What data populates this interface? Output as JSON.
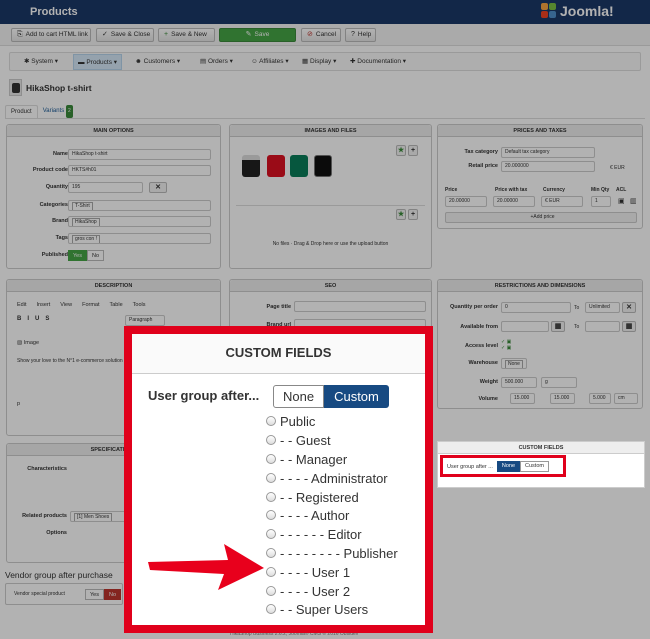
{
  "header": {
    "title": "Products",
    "brand": "Joomla!"
  },
  "toolbar": {
    "add_cart_link": "Add to cart HTML link",
    "save_close": "Save & Close",
    "save_new": "Save & New",
    "save": "Save",
    "cancel": "Cancel",
    "help": "Help"
  },
  "menu": [
    "System",
    "Products",
    "Customers",
    "Orders",
    "Affiliates",
    "Display",
    "Documentation"
  ],
  "product": {
    "name": "HikaShop t-shirt",
    "tab_product": "Product",
    "tab_variants": "Variants",
    "variants_count": "2"
  },
  "main_options": {
    "title": "MAIN OPTIONS",
    "name_label": "Name",
    "name_value": "HikaShop t-shirt",
    "code_label": "Product code",
    "code_value": "HKTS#h01",
    "quantity_label": "Quantity",
    "quantity_value": "195",
    "categories_label": "Categories",
    "categories_value": "T-Shirt",
    "brand_label": "Brand",
    "brand_value": "HikaShop",
    "tags_label": "Tags",
    "tags_value": "gros con !",
    "published_label": "Published",
    "yes": "Yes",
    "no": "No"
  },
  "images": {
    "title": "IMAGES AND FILES",
    "empty_files": "No files · Drag & Drop here or use the upload button"
  },
  "prices": {
    "title": "PRICES AND TAXES",
    "tax_label": "Tax category",
    "tax_value": "Default tax category",
    "retail_label": "Retail price",
    "retail_value": "20.000000",
    "retail_unit": "€ EUR",
    "col_price": "Price",
    "col_price_tax": "Price with tax",
    "col_currency": "Currency",
    "col_min_qty": "Min Qty",
    "col_acl": "ACL",
    "price_value": "20.00000",
    "price_tax_value": "20.00000",
    "currency_value": "€ EUR",
    "min_qty_value": "1",
    "add_price": "Add price"
  },
  "description": {
    "title": "DESCRIPTION",
    "menu": [
      "Edit",
      "Insert",
      "View",
      "Format",
      "Table",
      "Tools"
    ],
    "paragraph": "Paragraph",
    "image_btn": "Image",
    "body": "Show your love to the N°1 e-commerce solution",
    "status": "p"
  },
  "seo": {
    "title": "SEO",
    "page_title": "Page title",
    "brand_url": "Brand url"
  },
  "restrictions": {
    "title": "RESTRICTIONS AND DIMENSIONS",
    "qty_order_label": "Quantity per order",
    "qty_order_from": "0",
    "to": "To",
    "unlimited": "Unlimited",
    "available_label": "Available from",
    "access_label": "Access level",
    "warehouse_label": "Warehouse",
    "warehouse_value": "None",
    "weight_label": "Weight",
    "weight_value": "500.000",
    "weight_unit": "g",
    "volume_label": "Volume",
    "volume_values": [
      "15.000",
      "15.000",
      "5.000"
    ],
    "volume_unit": "cm"
  },
  "specifications": {
    "title": "SPECIFICATIONS",
    "characteristics_label": "Characteristics",
    "related_label": "Related products",
    "related_value": "[1] Men Shoes",
    "options_label": "Options"
  },
  "custom_fields_small": {
    "title": "CUSTOM FIELDS",
    "label": "User group after ...",
    "none": "None",
    "custom": "Custom"
  },
  "zoom": {
    "title": "CUSTOM FIELDS",
    "label": "User group after...",
    "none": "None",
    "custom": "Custom",
    "options": [
      "Public",
      "- - Guest",
      "- - Manager",
      "- - - - Administrator",
      "- - Registered",
      "- - - - Author",
      "- - - - - - Editor",
      "- - - - - - - - Publisher",
      "- - - - User 1",
      "- - - - User 2",
      "- - Super Users"
    ]
  },
  "vendor": {
    "title": "Vendor group after purchase",
    "special_label": "Vendor special product",
    "yes": "Yes",
    "no": "No"
  },
  "footer": "HikaShop Business 2.6.2, Joomla® CMS © 2016 Obsidev"
}
